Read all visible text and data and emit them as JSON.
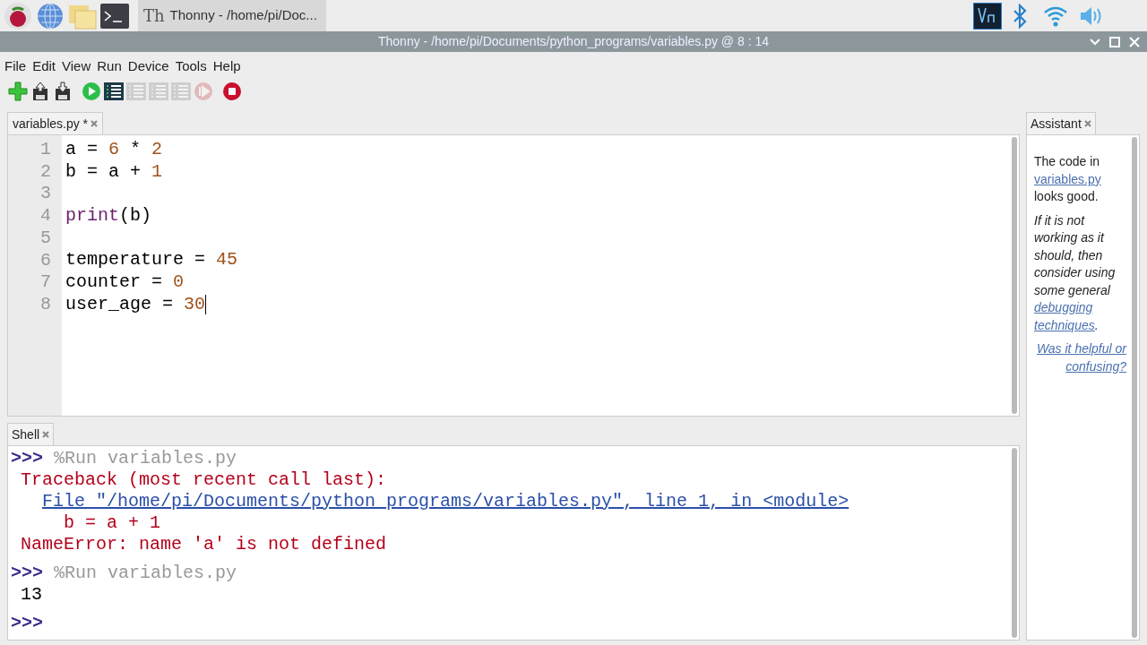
{
  "taskbar": {
    "logo": "Th",
    "window_button": "Thonny  -  /home/pi/Doc..."
  },
  "window": {
    "title": "Thonny  -  /home/pi/Documents/python_programs/variables.py  @  8 : 14"
  },
  "menu": [
    "File",
    "Edit",
    "View",
    "Run",
    "Device",
    "Tools",
    "Help"
  ],
  "toolbar": [
    {
      "kind": "new",
      "disabled": false
    },
    {
      "kind": "load",
      "disabled": false
    },
    {
      "kind": "save",
      "disabled": false
    },
    {
      "kind": "run",
      "disabled": false
    },
    {
      "kind": "debug",
      "disabled": false
    },
    {
      "kind": "step",
      "disabled": true
    },
    {
      "kind": "step",
      "disabled": true
    },
    {
      "kind": "step",
      "disabled": true
    },
    {
      "kind": "resume",
      "disabled": true
    },
    {
      "kind": "stop",
      "disabled": false
    }
  ],
  "editor": {
    "tab": "variables.py *",
    "lines": [
      {
        "number": "1",
        "tokens": [
          {
            "kind": "name",
            "text": "a = "
          },
          {
            "kind": "number",
            "text": "6"
          },
          {
            "kind": "name",
            "text": " * "
          },
          {
            "kind": "number",
            "text": "2"
          }
        ]
      },
      {
        "number": "2",
        "tokens": [
          {
            "kind": "name",
            "text": "b = a + "
          },
          {
            "kind": "number",
            "text": "1"
          }
        ]
      },
      {
        "number": "3"
      },
      {
        "number": "4",
        "tokens": [
          {
            "kind": "builtin",
            "text": "print"
          },
          {
            "kind": "name",
            "text": "(b)"
          }
        ]
      },
      {
        "number": "5"
      },
      {
        "number": "6",
        "tokens": [
          {
            "kind": "name",
            "text": "temperature = "
          },
          {
            "kind": "number",
            "text": "45"
          }
        ]
      },
      {
        "number": "7",
        "tokens": [
          {
            "kind": "name",
            "text": "counter = "
          },
          {
            "kind": "number",
            "text": "0"
          }
        ]
      },
      {
        "number": "8",
        "tokens": [
          {
            "kind": "name",
            "text": "user_age = "
          },
          {
            "kind": "number",
            "text": "30"
          }
        ]
      }
    ]
  },
  "shell": {
    "tab": "Shell",
    "lines": [
      {
        "kind": "prompt",
        "prompt": ">>>",
        "text": "%Run variables.py"
      },
      {
        "kind": "traceback",
        "text": "Traceback (most recent call last):"
      },
      {
        "kind": "link",
        "text": "File \"/home/pi/Documents/python_programs/variables.py\", line 1, in <module>"
      },
      {
        "kind": "source",
        "text": "b = a + 1"
      },
      {
        "kind": "traceback",
        "text": "NameError: name 'a' is not defined"
      },
      {
        "kind": "prompt",
        "prompt": ">>>",
        "text": "%Run variables.py"
      },
      {
        "kind": "output",
        "text": "13"
      },
      {
        "kind": "prompt",
        "prompt": ">>>"
      }
    ]
  },
  "assistant": {
    "tab": "Assistant",
    "paragraphs": [
      {
        "kind": "plain",
        "parts": [
          {
            "kind": "text",
            "text": "The code in "
          },
          {
            "kind": "link",
            "text": "variables.py"
          },
          {
            "kind": "text",
            "text": " looks good."
          }
        ]
      },
      {
        "kind": "note",
        "parts": [
          {
            "kind": "text",
            "text": "If it is not working as it should, then consider using some general "
          },
          {
            "kind": "link",
            "text": "debugging techniques"
          },
          {
            "kind": "text",
            "text": "."
          }
        ]
      },
      {
        "kind": "feedback",
        "parts": [
          {
            "kind": "link",
            "text": "Was it helpful or confusing?"
          }
        ]
      }
    ]
  }
}
